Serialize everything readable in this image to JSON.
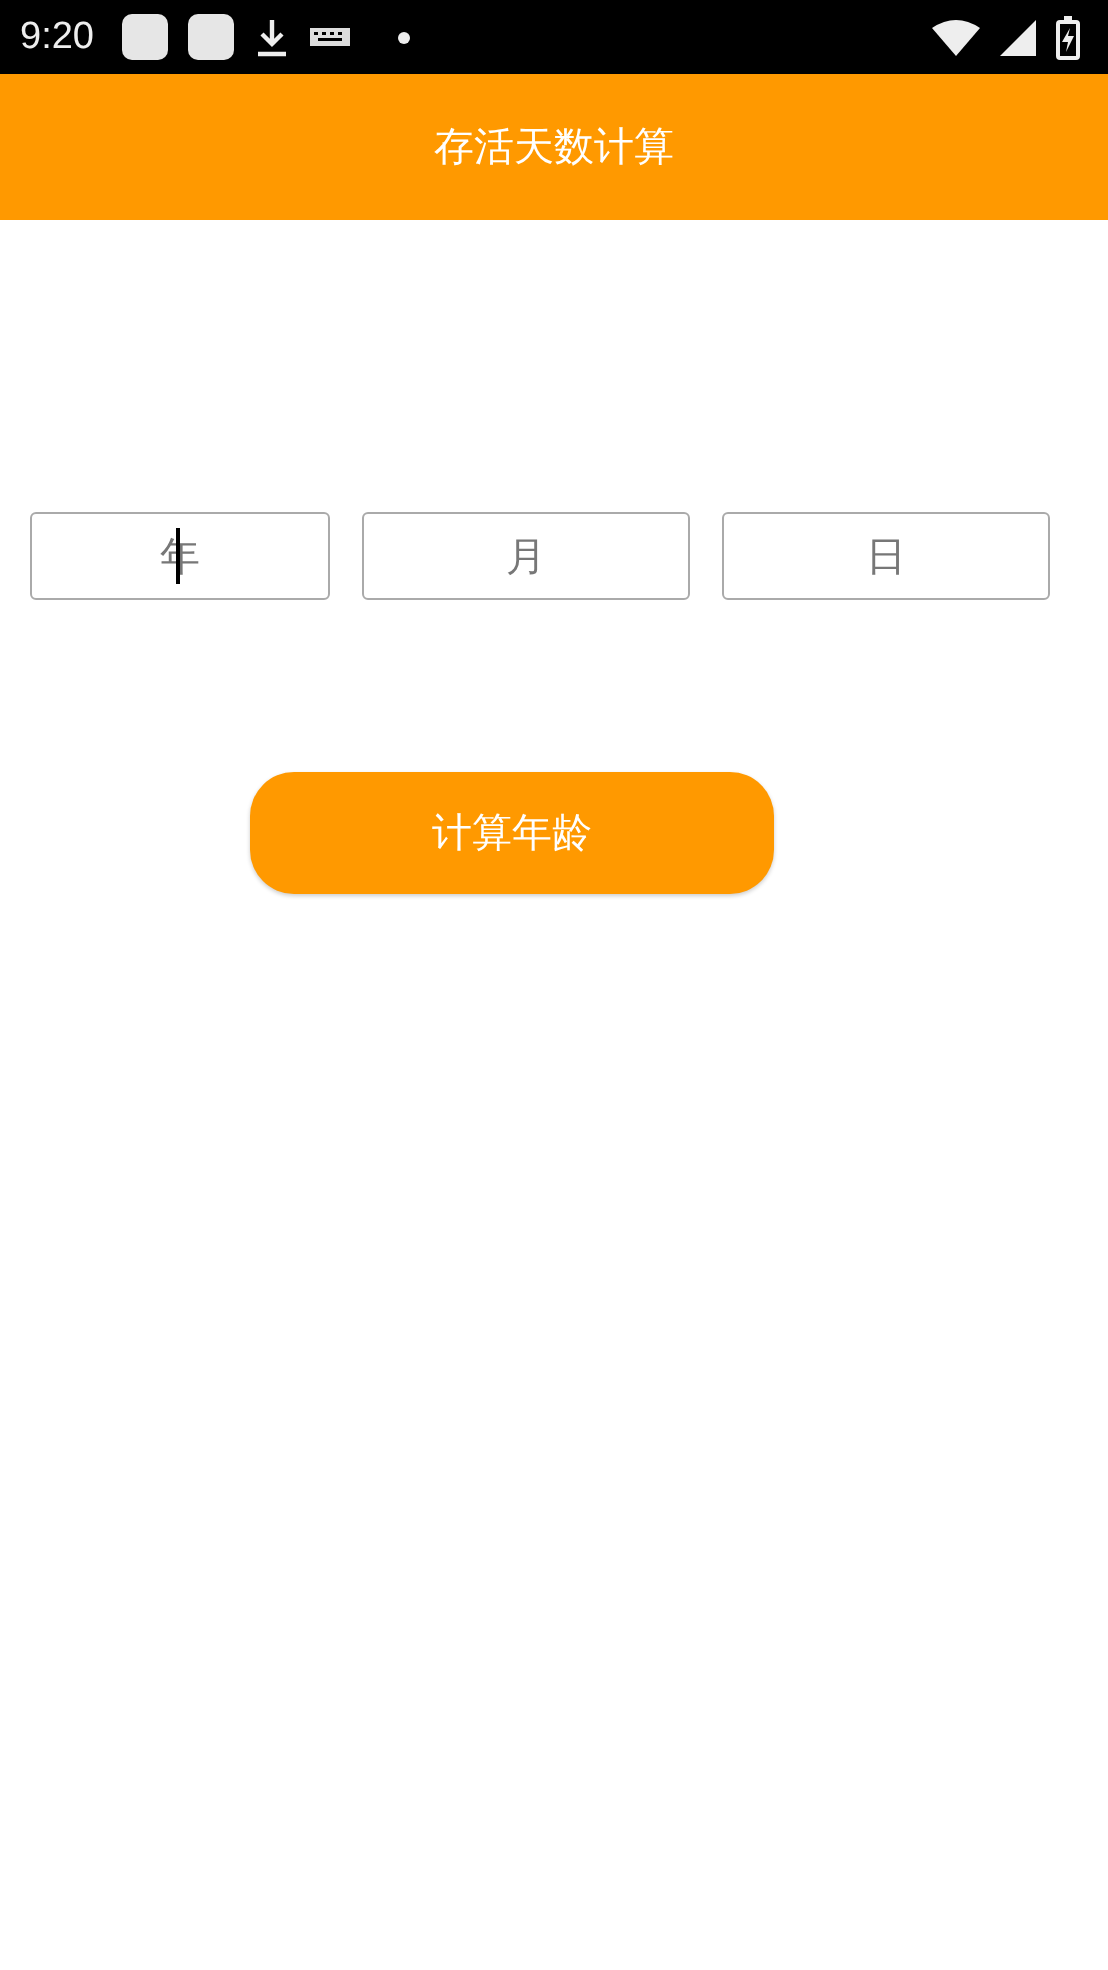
{
  "status_bar": {
    "time": "9:20"
  },
  "app_bar": {
    "title": "存活天数计算"
  },
  "fields": [
    {
      "placeholder": "年",
      "focused": true
    },
    {
      "placeholder": "月",
      "focused": false
    },
    {
      "placeholder": "日",
      "focused": false
    }
  ],
  "button": {
    "label": "计算年龄"
  }
}
